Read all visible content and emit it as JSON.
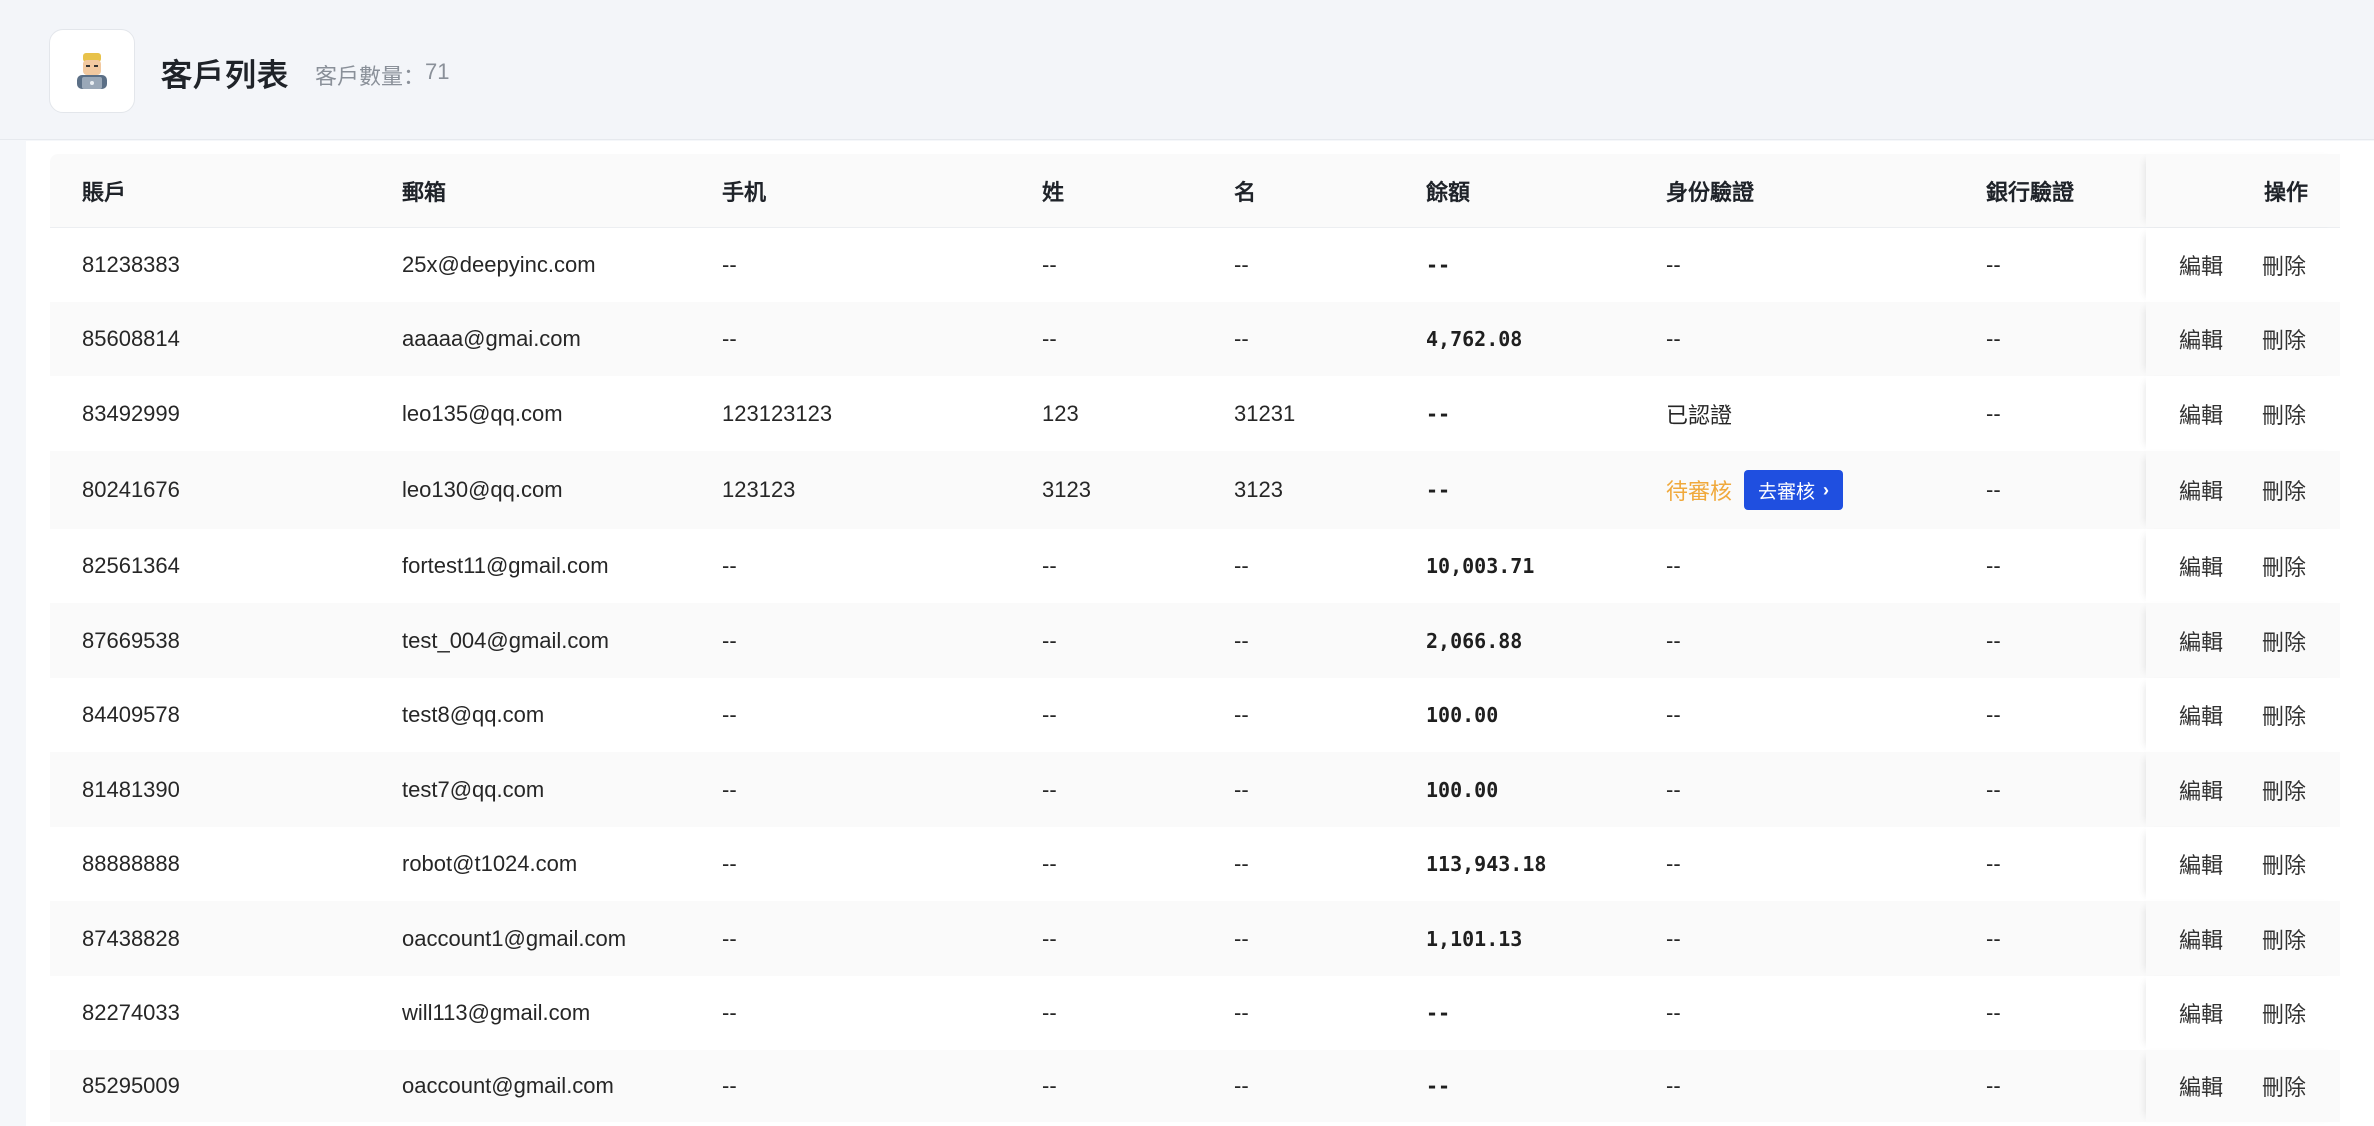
{
  "header": {
    "title": "客戶列表",
    "count_label": "客戶數量：",
    "count_value": "71"
  },
  "table": {
    "columns": [
      "賬戶",
      "郵箱",
      "手机",
      "姓",
      "名",
      "餘額",
      "身份驗證",
      "銀行驗證",
      "操作"
    ],
    "edit_label": "編輯",
    "delete_label": "刪除",
    "review_button_label": "去審核",
    "rows": [
      {
        "account": "81238383",
        "email": "25x@deepyinc.com",
        "phone": "--",
        "last": "--",
        "first": "--",
        "balance": "--",
        "id_verify": "--",
        "bank_verify": "--"
      },
      {
        "account": "85608814",
        "email": "aaaaa@gmai.com",
        "phone": "--",
        "last": "--",
        "first": "--",
        "balance": "4,762.08",
        "id_verify": "--",
        "bank_verify": "--"
      },
      {
        "account": "83492999",
        "email": "leo135@qq.com",
        "phone": "123123123",
        "last": "123",
        "first": "31231",
        "balance": "--",
        "id_verify": "已認證",
        "bank_verify": "--"
      },
      {
        "account": "80241676",
        "email": "leo130@qq.com",
        "phone": "123123",
        "last": "3123",
        "first": "3123",
        "balance": "--",
        "id_verify": "待審核",
        "bank_verify": "--",
        "pending": true
      },
      {
        "account": "82561364",
        "email": "fortest11@gmail.com",
        "phone": "--",
        "last": "--",
        "first": "--",
        "balance": "10,003.71",
        "id_verify": "--",
        "bank_verify": "--"
      },
      {
        "account": "87669538",
        "email": "test_004@gmail.com",
        "phone": "--",
        "last": "--",
        "first": "--",
        "balance": "2,066.88",
        "id_verify": "--",
        "bank_verify": "--"
      },
      {
        "account": "84409578",
        "email": "test8@qq.com",
        "phone": "--",
        "last": "--",
        "first": "--",
        "balance": "100.00",
        "id_verify": "--",
        "bank_verify": "--"
      },
      {
        "account": "81481390",
        "email": "test7@qq.com",
        "phone": "--",
        "last": "--",
        "first": "--",
        "balance": "100.00",
        "id_verify": "--",
        "bank_verify": "--"
      },
      {
        "account": "88888888",
        "email": "robot@t1024.com",
        "phone": "--",
        "last": "--",
        "first": "--",
        "balance": "113,943.18",
        "id_verify": "--",
        "bank_verify": "--"
      },
      {
        "account": "87438828",
        "email": "oaccount1@gmail.com",
        "phone": "--",
        "last": "--",
        "first": "--",
        "balance": "1,101.13",
        "id_verify": "--",
        "bank_verify": "--"
      },
      {
        "account": "82274033",
        "email": "will113@gmail.com",
        "phone": "--",
        "last": "--",
        "first": "--",
        "balance": "--",
        "id_verify": "--",
        "bank_verify": "--"
      },
      {
        "account": "85295009",
        "email": "oaccount@gmail.com",
        "phone": "--",
        "last": "--",
        "first": "--",
        "balance": "--",
        "id_verify": "--",
        "bank_verify": "--"
      }
    ]
  },
  "colors": {
    "pending": "#f0a93c",
    "review_button": "#1f4fe0"
  }
}
